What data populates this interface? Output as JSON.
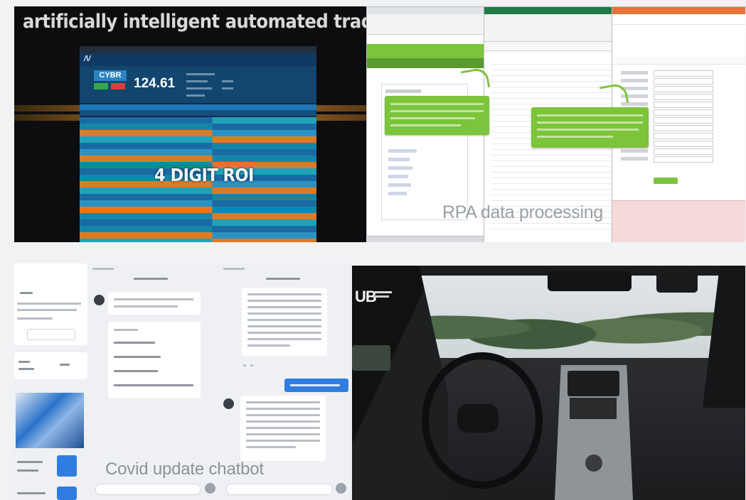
{
  "panels": {
    "trading": {
      "caption": "artificially intelligent automated trading",
      "overlay_text": "4 DIGIT ROI",
      "ticker": "CYBR",
      "price": "124.61"
    },
    "rpa": {
      "caption": "RPA data processing"
    },
    "chatbot": {
      "caption": "Covid update chatbot"
    },
    "car": {
      "logo": "UB"
    }
  },
  "colors": {
    "callout_green": "#7cc43a",
    "trading_blue": "#0b2d4e",
    "trading_orange": "#e07a22",
    "trading_teal": "#1fa3b8",
    "chat_blue": "#2f7de1"
  },
  "icons": [
    "chatbot-avatar-icon",
    "send-icon",
    "callout-arrow-icon"
  ]
}
